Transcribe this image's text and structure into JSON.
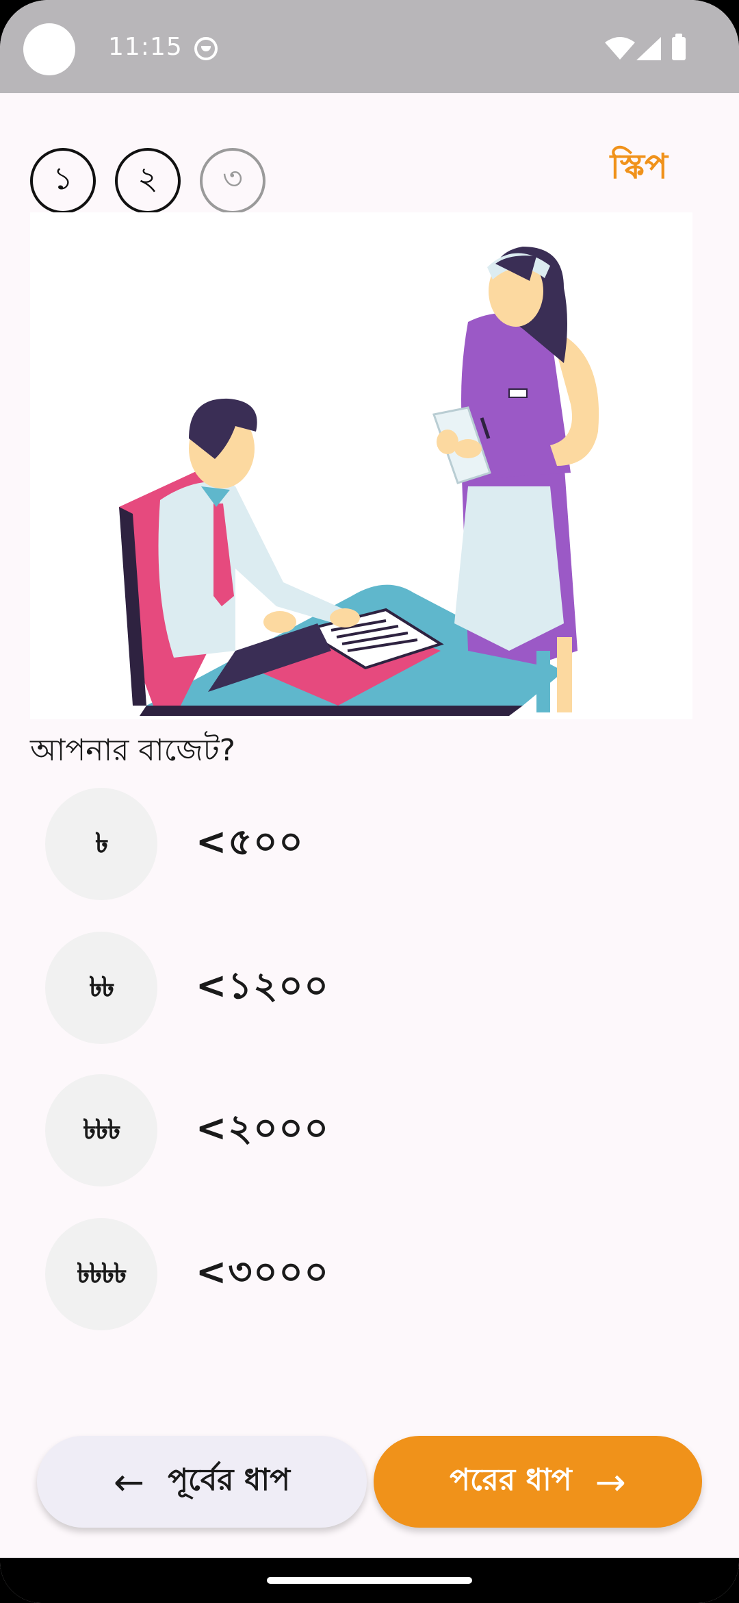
{
  "status_bar": {
    "time": "11:15"
  },
  "stepper": {
    "steps": [
      "১",
      "২",
      "৩"
    ],
    "active_count": 2,
    "skip_label": "স্কিপ"
  },
  "question": "আপনার বাজেট?",
  "options": [
    {
      "icon_text": "৳",
      "label": "<৫০০"
    },
    {
      "icon_text": "৳৳",
      "label": "<১২০০"
    },
    {
      "icon_text": "৳৳৳",
      "label": "<২০০০"
    },
    {
      "icon_text": "৳৳৳৳",
      "label": "<৩০০০"
    }
  ],
  "footer": {
    "prev_label": "পূর্বের ধাপ",
    "next_label": "পরের ধাপ"
  },
  "colors": {
    "accent": "#f0921a",
    "background": "#fdf8fb",
    "status_bar": "#b8b6b9"
  },
  "icons": {
    "illustration": "restaurant-order-illustration",
    "prev_arrow": "arrow-left-icon",
    "next_arrow": "arrow-right-icon"
  }
}
